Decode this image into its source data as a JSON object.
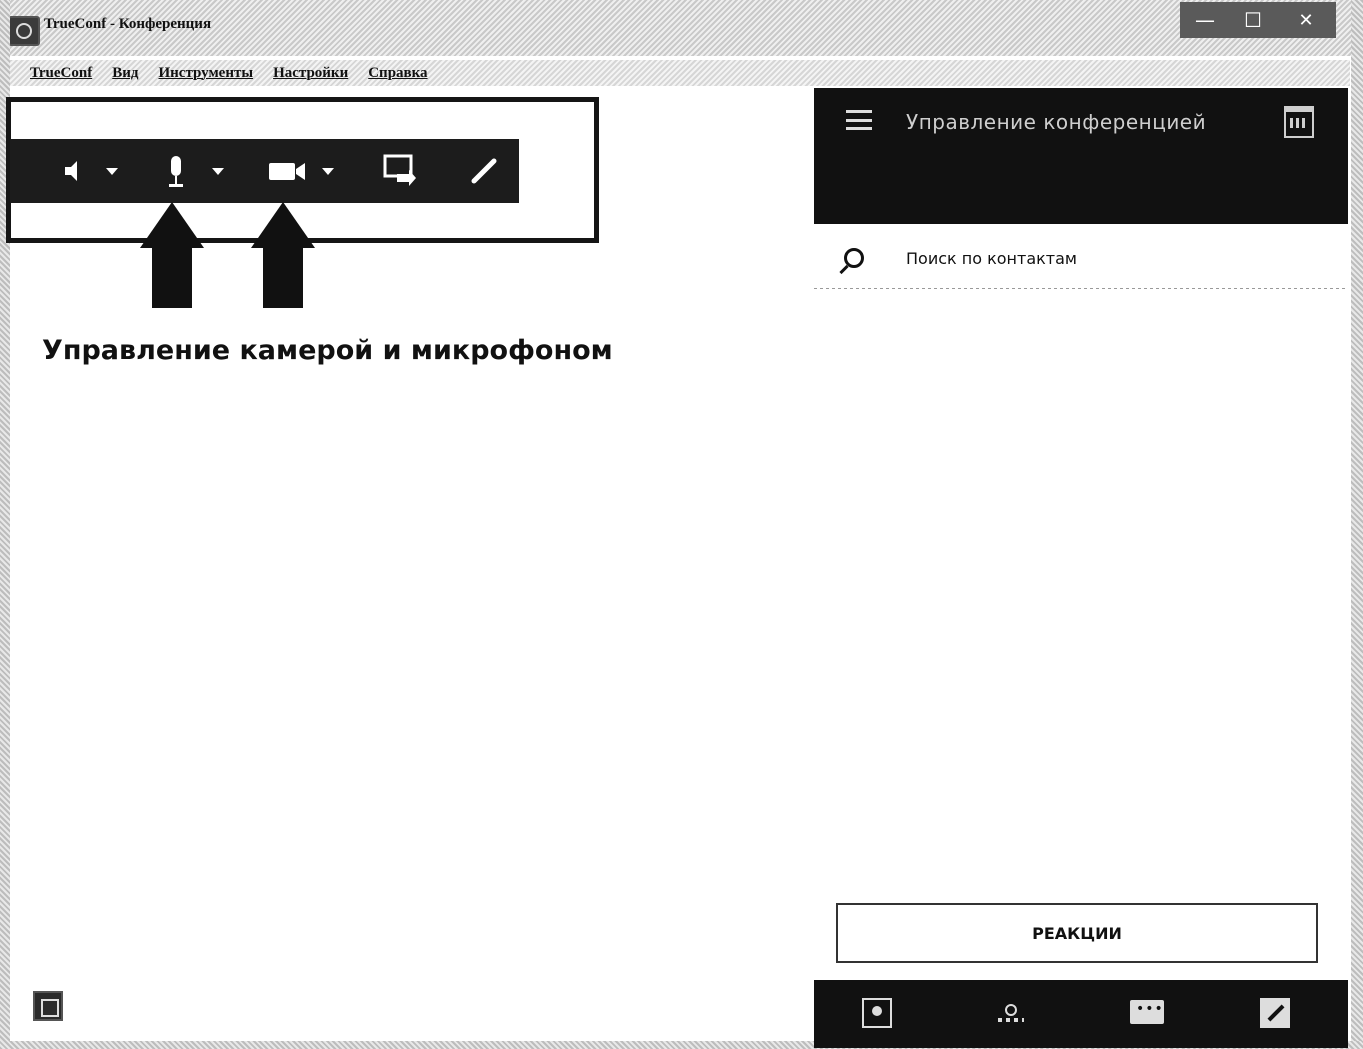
{
  "window": {
    "title": "TrueConf - Конференция",
    "controls": {
      "minimize": "—",
      "maximize": "☐",
      "close": "✕"
    }
  },
  "menubar": {
    "items": [
      "TrueConf",
      "Вид",
      "Инструменты",
      "Настройки",
      "Справка"
    ]
  },
  "toolbar": {
    "items": [
      {
        "name": "speaker",
        "icon": "speaker-icon"
      },
      {
        "name": "microphone",
        "icon": "microphone-icon"
      },
      {
        "name": "camera",
        "icon": "camera-icon"
      },
      {
        "name": "share-screen",
        "icon": "share-screen-icon"
      },
      {
        "name": "draw",
        "icon": "pen-icon"
      }
    ]
  },
  "annotation": {
    "caption": "Управление камерой и микрофоном"
  },
  "right_panel": {
    "title": "Управление конференцией",
    "search": {
      "placeholder": "Поиск по контактам",
      "value": ""
    },
    "reactions_label": "РЕАКЦИИ",
    "bottom_bar": [
      {
        "name": "contacts",
        "icon": "contacts-icon"
      },
      {
        "name": "participants",
        "icon": "participants-icon"
      },
      {
        "name": "chat",
        "icon": "chat-icon"
      },
      {
        "name": "draw",
        "icon": "pen-icon"
      }
    ]
  },
  "colors": {
    "toolbar_bg": "#1c1c1c",
    "panel_header_bg": "#111111",
    "accent_text": "#cfcfcf"
  }
}
